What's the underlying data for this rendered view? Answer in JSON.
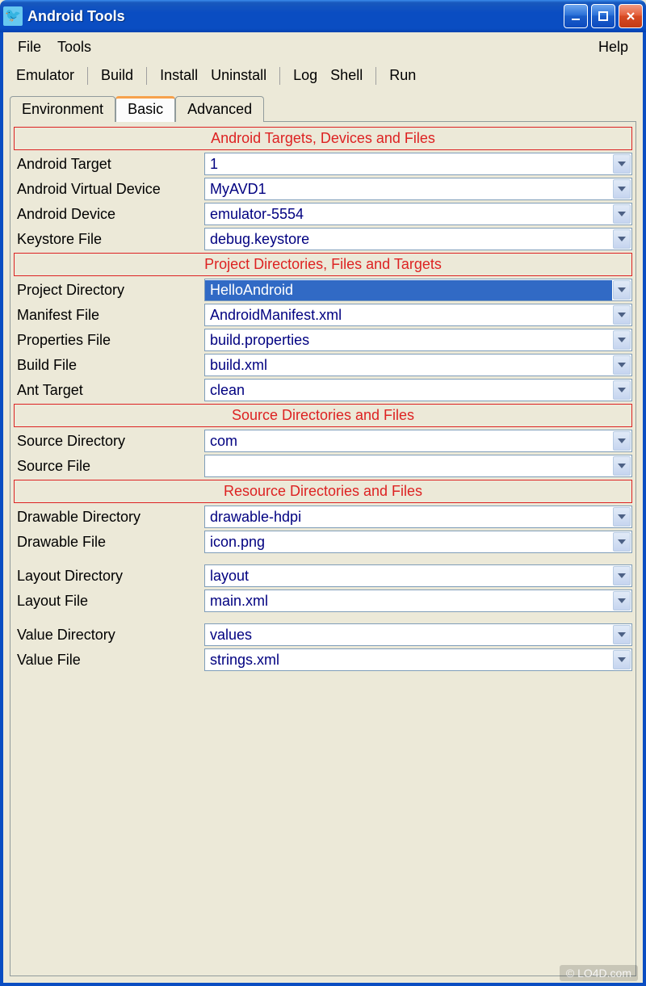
{
  "window": {
    "title": "Android Tools"
  },
  "menu": {
    "file": "File",
    "tools": "Tools",
    "help": "Help"
  },
  "toolbar": {
    "emulator": "Emulator",
    "build": "Build",
    "install": "Install",
    "uninstall": "Uninstall",
    "log": "Log",
    "shell": "Shell",
    "run": "Run"
  },
  "tabs": {
    "environment": "Environment",
    "basic": "Basic",
    "advanced": "Advanced"
  },
  "sections": {
    "targets": {
      "title": "Android Targets, Devices and Files",
      "rows": [
        {
          "label": "Android Target",
          "value": "1"
        },
        {
          "label": "Android Virtual Device",
          "value": "MyAVD1"
        },
        {
          "label": "Android Device",
          "value": "emulator-5554"
        },
        {
          "label": "Keystore File",
          "value": "debug.keystore"
        }
      ]
    },
    "project": {
      "title": "Project Directories, Files and Targets",
      "rows": [
        {
          "label": "Project Directory",
          "value": "HelloAndroid",
          "selected": true
        },
        {
          "label": "Manifest File",
          "value": "AndroidManifest.xml"
        },
        {
          "label": "Properties File",
          "value": "build.properties"
        },
        {
          "label": "Build File",
          "value": "build.xml"
        },
        {
          "label": "Ant Target",
          "value": "clean"
        }
      ]
    },
    "source": {
      "title": "Source Directories and Files",
      "rows": [
        {
          "label": "Source Directory",
          "value": "com"
        },
        {
          "label": "Source File",
          "value": ""
        }
      ]
    },
    "resource": {
      "title": "Resource Directories and Files",
      "rows": [
        {
          "label": "Drawable Directory",
          "value": "drawable-hdpi"
        },
        {
          "label": "Drawable File",
          "value": "icon.png"
        },
        {
          "label": "Layout Directory",
          "value": "layout"
        },
        {
          "label": "Layout File",
          "value": "main.xml"
        },
        {
          "label": "Value Directory",
          "value": "values"
        },
        {
          "label": "Value File",
          "value": "strings.xml"
        }
      ]
    }
  },
  "watermark": "© LO4D.com"
}
